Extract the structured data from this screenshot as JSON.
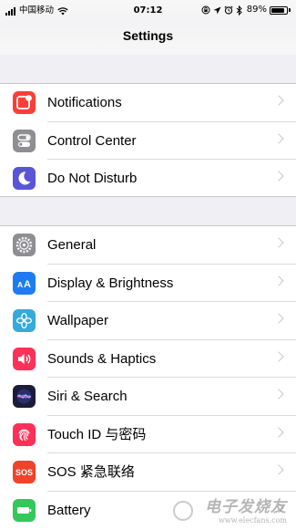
{
  "status_bar": {
    "carrier": "中国移动",
    "time": "07:12",
    "battery_percent": "89%",
    "battery_level": 0.89,
    "icons": [
      "signal-icon",
      "wifi-icon",
      "orientation-lock-icon",
      "location-icon",
      "alarm-icon",
      "bluetooth-icon",
      "battery-icon"
    ]
  },
  "header": {
    "title": "Settings"
  },
  "group1": [
    {
      "label": "Notifications",
      "icon": "notifications-icon",
      "color": "#fc3d39"
    },
    {
      "label": "Control Center",
      "icon": "control-center-icon",
      "color": "#8e8e93"
    },
    {
      "label": "Do Not Disturb",
      "icon": "moon-icon",
      "color": "#5856d6"
    }
  ],
  "group2": [
    {
      "label": "General",
      "icon": "gear-icon",
      "color": "#8e8e93"
    },
    {
      "label": "Display & Brightness",
      "icon": "display-icon",
      "color": "#1e7cf2"
    },
    {
      "label": "Wallpaper",
      "icon": "wallpaper-icon",
      "color": "#35aadc"
    },
    {
      "label": "Sounds & Haptics",
      "icon": "speaker-icon",
      "color": "#fc3158"
    },
    {
      "label": "Siri & Search",
      "icon": "siri-icon",
      "color": "#1c1c3a"
    },
    {
      "label": "Touch ID 与密码",
      "icon": "fingerprint-icon",
      "color": "#fc3158"
    },
    {
      "label": "SOS 紧急联络",
      "icon": "sos-icon",
      "color": "#f0432b",
      "icon_text": "SOS"
    },
    {
      "label": "Battery",
      "icon": "battery-setting-icon",
      "color": "#34c759"
    }
  ],
  "watermark": {
    "text": "电子发烧友",
    "url": "www.elecfans.com"
  }
}
